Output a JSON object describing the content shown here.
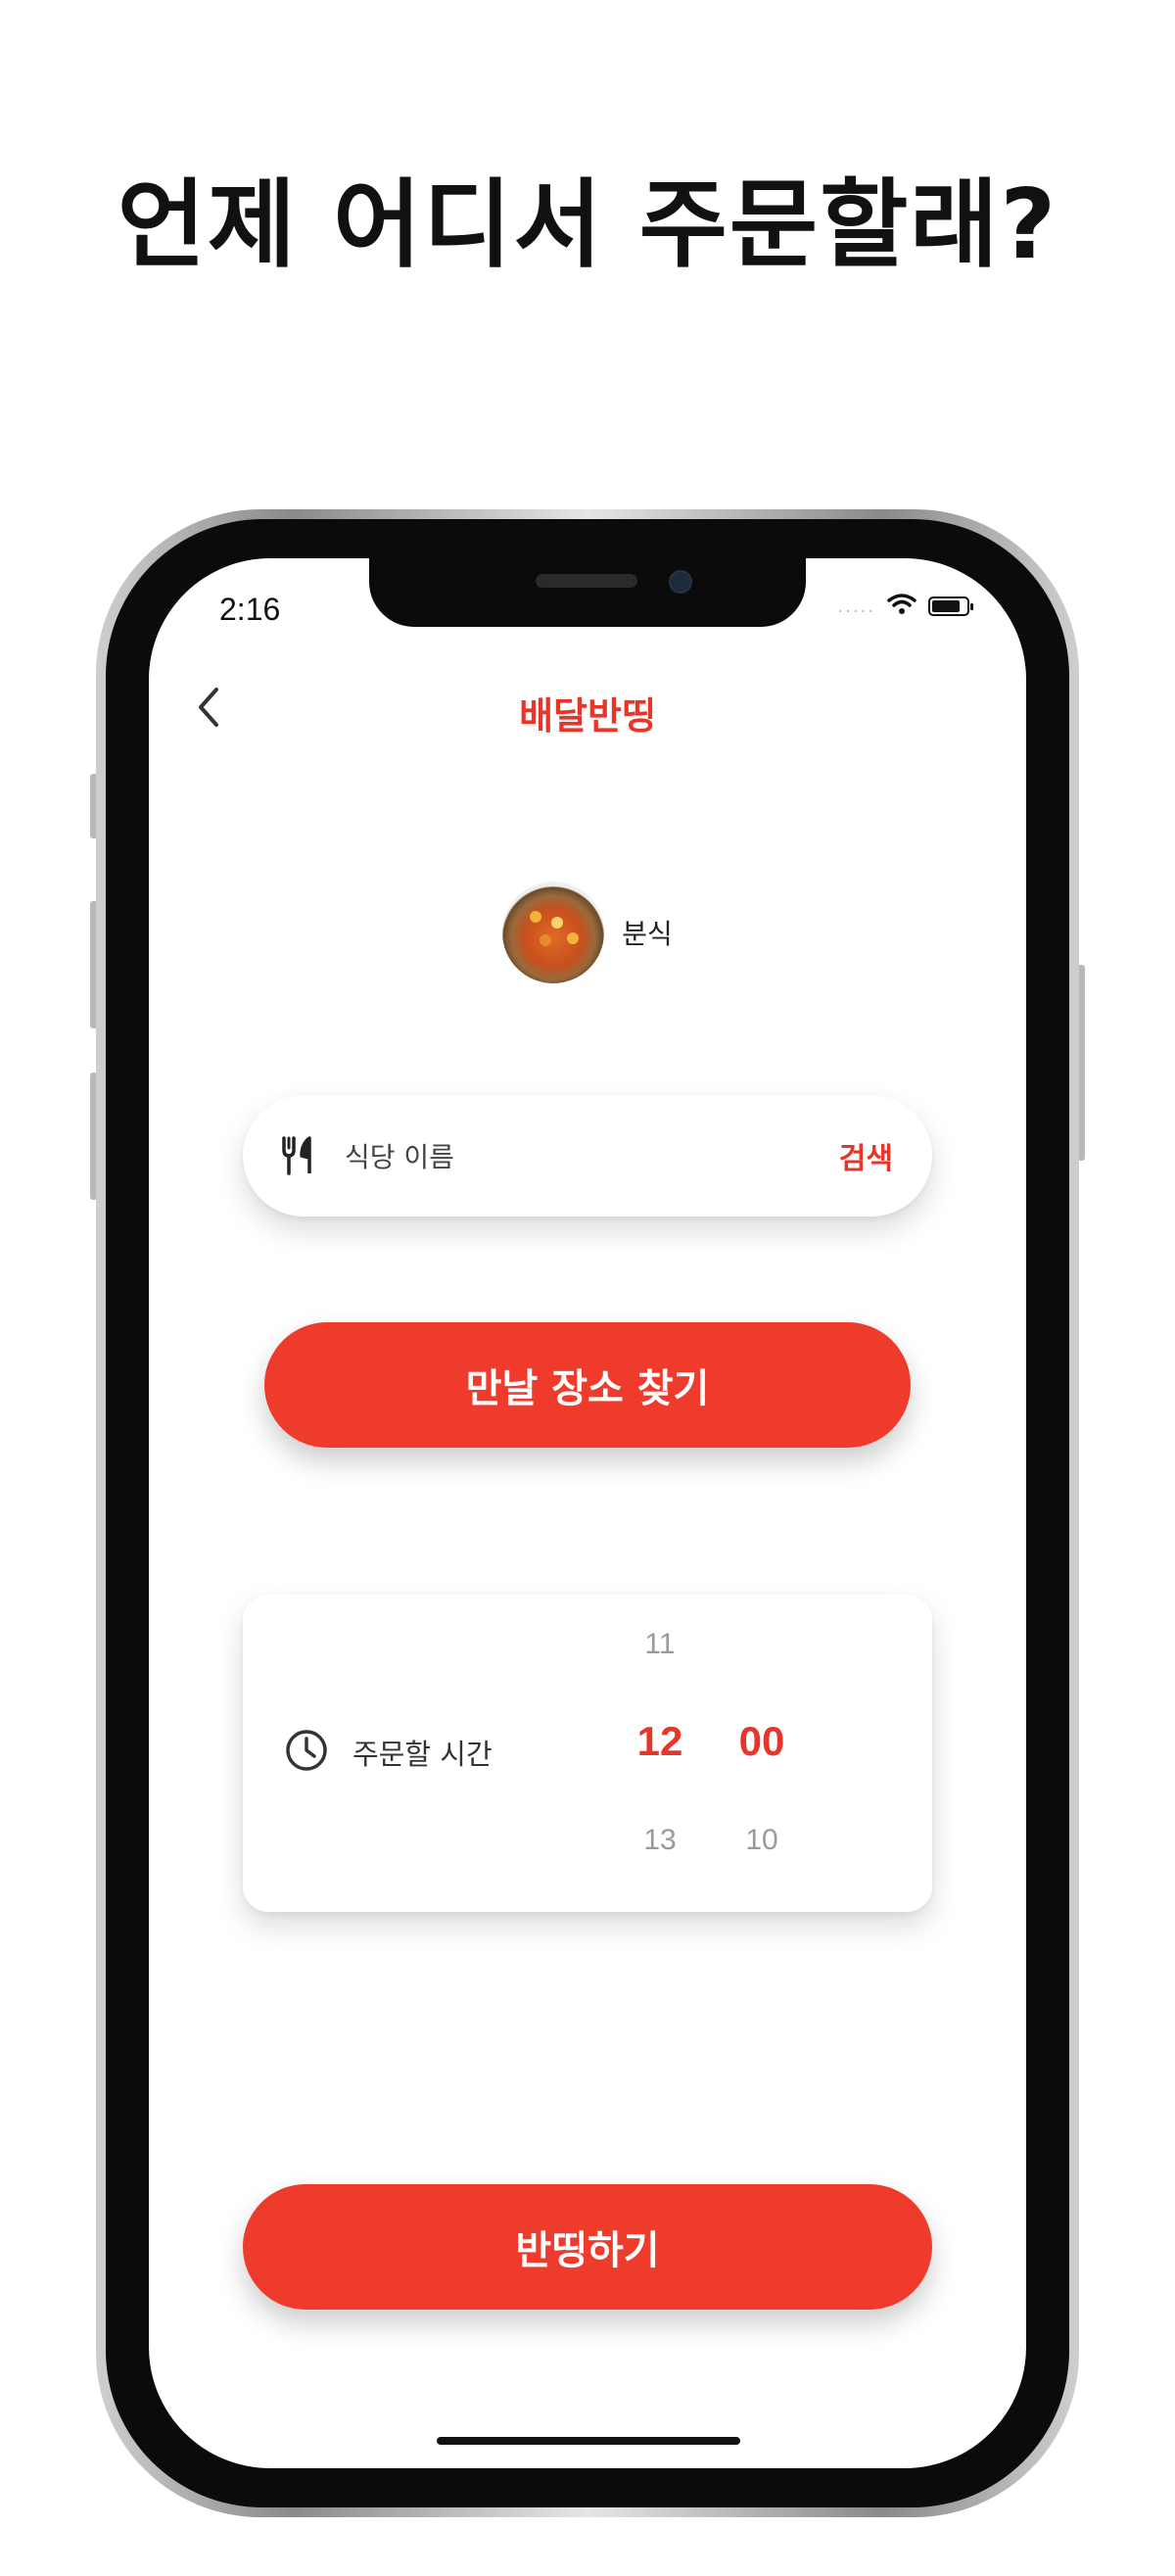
{
  "headline": "언제 어디서 주문할래?",
  "status_bar": {
    "time": "2:16",
    "signal": "....."
  },
  "nav": {
    "title": "배달반띵"
  },
  "category": {
    "label": "분식",
    "image": "tteokbokki-bowl"
  },
  "search": {
    "placeholder": "식당 이름",
    "button_label": "검색",
    "icon": "fork-knife-icon"
  },
  "meet_button": {
    "label": "만날 장소 찾기"
  },
  "order_time": {
    "label": "주문할 시간",
    "icon": "clock-icon",
    "hour": {
      "prev": "11",
      "selected": "12",
      "next": "13"
    },
    "minute": {
      "prev": "",
      "selected": "00",
      "next": "10"
    }
  },
  "submit_button": {
    "label": "반띵하기"
  },
  "colors": {
    "accent": "#ef3b2c",
    "title_red": "#e8352a"
  }
}
